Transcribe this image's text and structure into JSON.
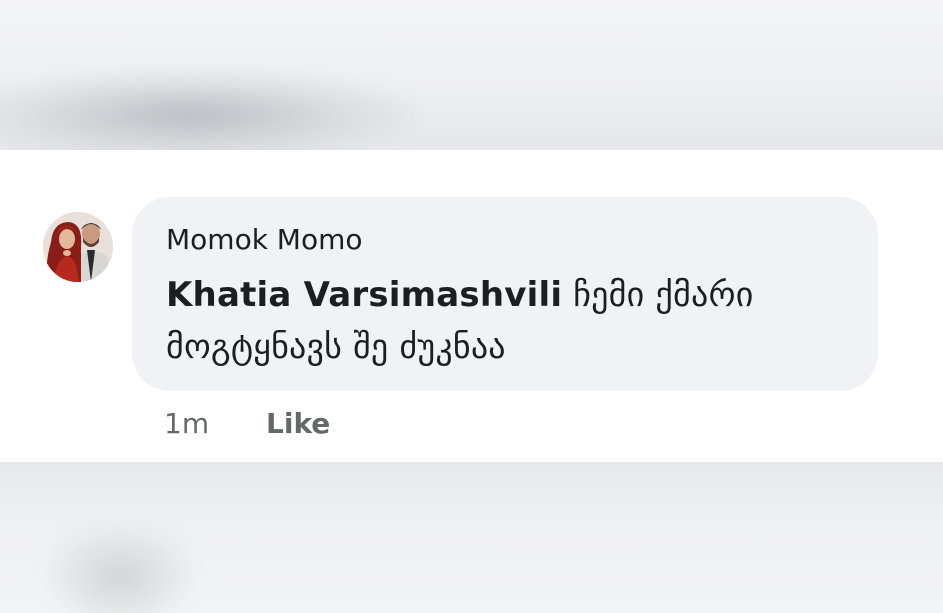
{
  "comment": {
    "author": "Momok Momo",
    "mention": "Khatia Varsimashvili",
    "text": "ჩემი ქმარი მოგტყნავს შე ძუკნაა",
    "timestamp": "1m",
    "like_label": "Like"
  },
  "icons": {
    "avatar": "profile-photo"
  },
  "colors": {
    "bubble": "#f0f2f5",
    "text": "#1c1e21",
    "meta": "#65676b",
    "background": "#ffffff"
  }
}
